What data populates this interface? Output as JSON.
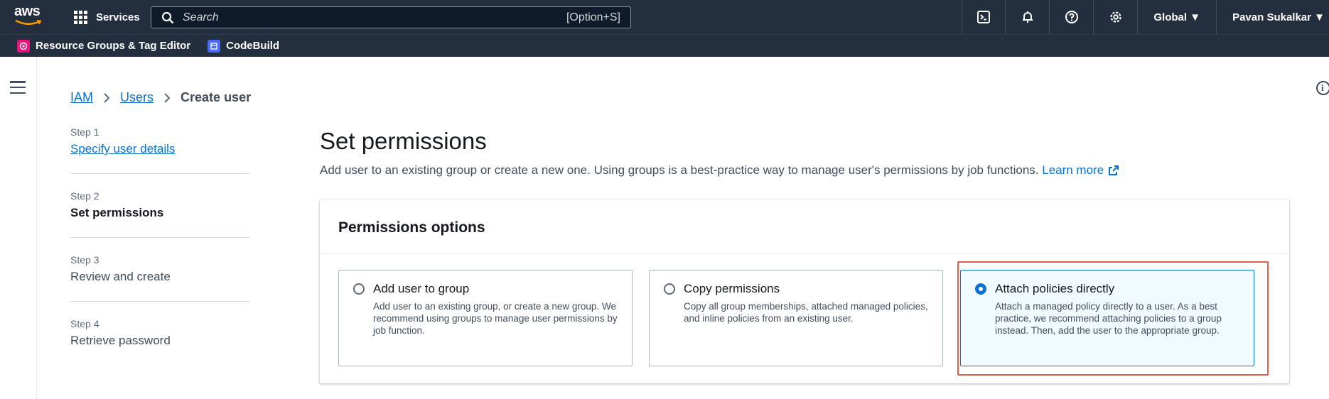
{
  "topnav": {
    "logo_text": "aws",
    "services_label": "Services",
    "search_placeholder": "Search",
    "search_shortcut": "[Option+S]",
    "region_label": "Global ▼",
    "user_label": "Pavan Sukalkar ▼"
  },
  "favorites": [
    {
      "label": "Resource Groups & Tag Editor",
      "icon": "resource-groups-icon",
      "color": "#e7157b"
    },
    {
      "label": "CodeBuild",
      "icon": "codebuild-icon",
      "color": "#4a6cf7"
    }
  ],
  "breadcrumb": {
    "items": [
      "IAM",
      "Users"
    ],
    "current": "Create user"
  },
  "steps": [
    {
      "number": "Step 1",
      "label": "Specify user details"
    },
    {
      "number": "Step 2",
      "label": "Set permissions"
    },
    {
      "number": "Step 3",
      "label": "Review and create"
    },
    {
      "number": "Step 4",
      "label": "Retrieve password"
    }
  ],
  "main": {
    "title": "Set permissions",
    "description": "Add user to an existing group or create a new one. Using groups is a best-practice way to manage user's permissions by job functions.",
    "learn_more": "Learn more",
    "panel_title": "Permissions options",
    "options": [
      {
        "title": "Add user to group",
        "description": "Add user to an existing group, or create a new group. We recommend using groups to manage user permissions by job function.",
        "selected": false
      },
      {
        "title": "Copy permissions",
        "description": "Copy all group memberships, attached managed policies, and inline policies from an existing user.",
        "selected": false
      },
      {
        "title": "Attach policies directly",
        "description": "Attach a managed policy directly to a user. As a best practice, we recommend attaching policies to a group instead. Then, add the user to the appropriate group.",
        "selected": true
      }
    ]
  },
  "colors": {
    "nav_bg": "#232f3e",
    "link": "#0972d3",
    "selected_bg": "#f1faff",
    "highlight": "#e35d4e"
  }
}
